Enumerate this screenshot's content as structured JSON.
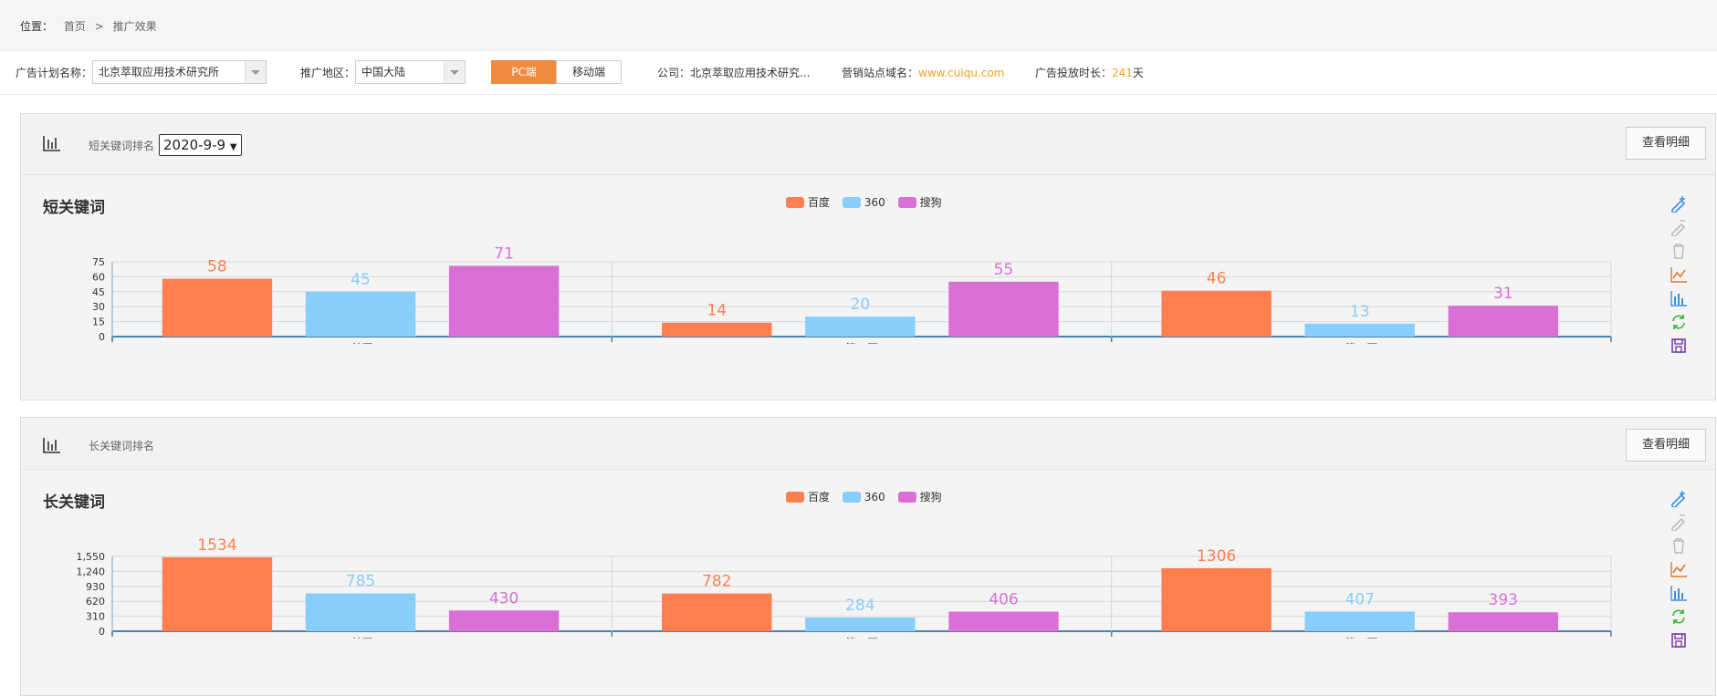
{
  "breadcrumb": {
    "label": "位置：",
    "home": "首页",
    "separator": ">",
    "current": "推广效果"
  },
  "filters": {
    "plan_label": "广告计划名称：",
    "plan_value": "北京萃取应用技术研究所",
    "region_label": "推广地区：",
    "region_value": "中国大陆",
    "platform_pc": "PC端",
    "platform_mobile": "移动端",
    "company_label": "公司：",
    "company_value": "北京萃取应用技术研究...",
    "site_label": "营销站点域名：",
    "site_value": "www.cuiqu.com",
    "duration_label": "广告投放时长：",
    "duration_value": "241",
    "duration_unit": "天"
  },
  "colors": {
    "baidu": "#ff7f50",
    "q360": "#87cefa",
    "sogou": "#da70d6",
    "accent": "#f08a3e",
    "site": "#f0a020"
  },
  "panels": [
    {
      "subtitle": "短关键词排名",
      "date": "2020-9-9",
      "detail_button": "查看明细",
      "icon": "bar-chart-icon",
      "chart_title": "短关键词"
    },
    {
      "subtitle": "长关键词排名",
      "detail_button": "查看明细",
      "icon": "bar-chart-icon",
      "chart_title": "长关键词"
    }
  ],
  "toolbox_icons": [
    "pencil-zoom-icon",
    "pencil-disabled-icon",
    "trash-icon",
    "line-chart-icon",
    "bar-chart-icon",
    "refresh-icon",
    "save-icon"
  ],
  "chart_data": [
    {
      "type": "bar",
      "title": "短关键词",
      "categories": [
        "首页",
        "第二页",
        "第三页"
      ],
      "series": [
        {
          "name": "百度",
          "values": [
            58,
            14,
            46
          ]
        },
        {
          "name": "360",
          "values": [
            45,
            20,
            13
          ]
        },
        {
          "name": "搜狗",
          "values": [
            71,
            55,
            31
          ]
        }
      ],
      "yticks": [
        "0",
        "15",
        "30",
        "45",
        "60",
        "75"
      ],
      "ylim": [
        0,
        75
      ],
      "grid": true,
      "legend": "top-center"
    },
    {
      "type": "bar",
      "title": "长关键词",
      "categories": [
        "首页",
        "第二页",
        "第三页"
      ],
      "series": [
        {
          "name": "百度",
          "values": [
            1534,
            782,
            1306
          ]
        },
        {
          "name": "360",
          "values": [
            785,
            284,
            407
          ]
        },
        {
          "name": "搜狗",
          "values": [
            430,
            406,
            393
          ]
        }
      ],
      "yticks": [
        "0",
        "310",
        "620",
        "930",
        "1,240",
        "1,550"
      ],
      "ylim": [
        0,
        1550
      ],
      "grid": true,
      "legend": "top-center"
    }
  ]
}
